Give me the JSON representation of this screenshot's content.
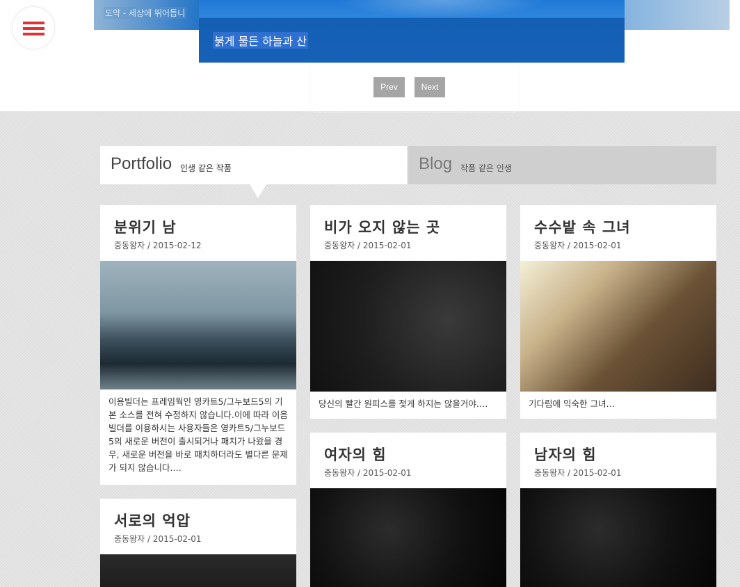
{
  "slider": {
    "back_caption": "도약 - 세상에 뛰어듭니",
    "front_caption": "붉게 물든 하늘과 산",
    "prev_label": "Prev",
    "next_label": "Next"
  },
  "tabs": [
    {
      "title": "Portfolio",
      "subtitle": "인생 같은 작품",
      "active": true
    },
    {
      "title": "Blog",
      "subtitle": "작품 같은 인생",
      "active": false
    }
  ],
  "posts": [
    {
      "title": "분위기 남",
      "meta": "중동왕자 / 2015-02-12",
      "excerpt": "이용빌더는 프레임웍인 영카트5/그누보드5의 기본 소스를 전혀 수정하지 않습니다.이에 따라 이음빌더를 이용하시는 사용자들은 영카트5/그누보드5의 새로운 버전이 출시되거나 패치가 나왔을 경우, 새로운 버전을 바로 패치하더라도 별다른 문제가 되지 않습니다.…"
    },
    {
      "title": "비가 오지 않는 곳",
      "meta": "중동왕자 / 2015-02-01",
      "excerpt": "당신의 빨간 원피스를 젖게 하지는 않을거야.…"
    },
    {
      "title": "수수밭 속 그녀",
      "meta": "중동왕자 / 2015-02-01",
      "excerpt": "기다림에 익숙한 그녀…"
    },
    {
      "title": "여자의 힘",
      "meta": "중동왕자 / 2015-02-01"
    },
    {
      "title": "남자의 힘",
      "meta": "중동왕자 / 2015-02-01"
    },
    {
      "title": "서로의 억압",
      "meta": "중동왕자 / 2015-02-01"
    }
  ],
  "colors": {
    "accent": "#e03333",
    "slide_blue": "#1761b7",
    "pager_gray": "#a5a5a5"
  }
}
